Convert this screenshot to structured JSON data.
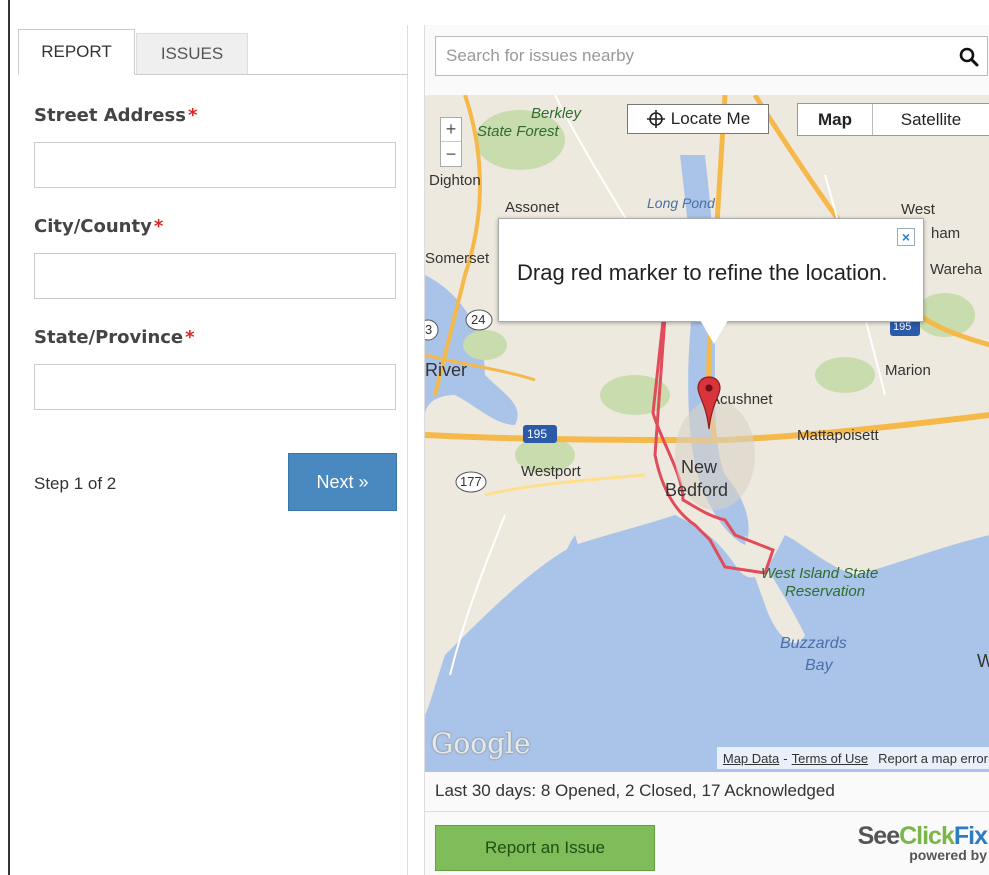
{
  "tabs": [
    {
      "label": "REPORT",
      "active": true
    },
    {
      "label": "ISSUES",
      "active": false
    }
  ],
  "form": {
    "fields": [
      {
        "label": "Street Address",
        "required_mark": "*",
        "value": ""
      },
      {
        "label": "City/County",
        "required_mark": "*",
        "value": ""
      },
      {
        "label": "State/Province",
        "required_mark": "*",
        "value": ""
      }
    ],
    "step_text": "Step 1 of 2",
    "next_label": "Next »"
  },
  "search": {
    "placeholder": "Search for issues nearby",
    "value": ""
  },
  "map": {
    "zoom_in": "+",
    "zoom_out": "−",
    "locate_label": "Locate Me",
    "type_map": "Map",
    "type_satellite": "Satellite",
    "active_type": "Map",
    "popup_text": "Drag red marker to refine the location.",
    "popup_close": "×",
    "google_logo": "Google",
    "attribution": {
      "map_data": "Map Data",
      "separator": "-",
      "terms": "Terms of Use",
      "report_error": "Report a map error"
    },
    "places": {
      "berkley": "Berkley",
      "berkley_forest": "State Forest",
      "dighton": "Dighton",
      "assonet": "Assonet",
      "long_pond": "Long Pond",
      "west": "West",
      "wareham_part": "ham",
      "somerset": "Somerset",
      "wareha": "Wareha",
      "river": "River",
      "marion": "Marion",
      "acushnet": "Acushnet",
      "mattapoisett": "Mattapoisett",
      "westport": "Westport",
      "new": "New",
      "bedford": "Bedford",
      "west_island": "West Island State",
      "reservation": "Reservation",
      "buzzards": "Buzzards",
      "bay": "Bay",
      "w": "W"
    },
    "shields": {
      "i195_west": "195",
      "i195_east": "195",
      "rt24": "24",
      "rt177": "177",
      "rt3": "3"
    },
    "colors": {
      "water": "#a9c4e8",
      "land": "#eee9df",
      "highway": "#f5b94a",
      "boundary": "#e14b5a",
      "park": "#c8dcae"
    }
  },
  "stats_text": "Last 30 days: 8 Opened, 2 Closed, 17 Acknowledged",
  "report_button": "Report an Issue",
  "brand": {
    "see": "See",
    "click": "Click",
    "fix": "Fix",
    "powered": "powered by"
  }
}
